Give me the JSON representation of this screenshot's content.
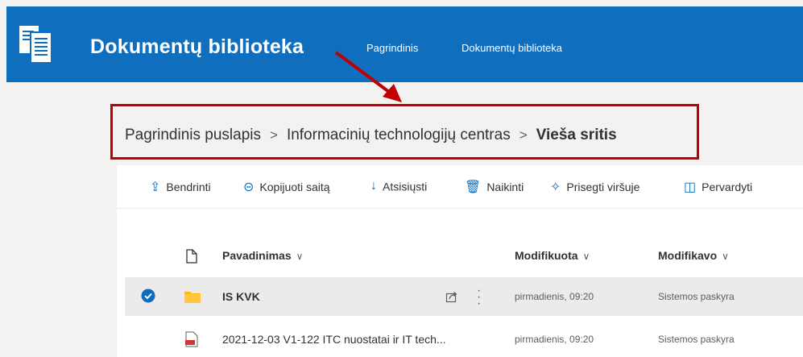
{
  "header": {
    "title": "Dokumentų biblioteka",
    "nav": [
      "Pagrindinis",
      "Dokumentų biblioteka"
    ],
    "background": "#106ebe"
  },
  "breadcrumb": {
    "items": [
      "Pagrindinis puslapis",
      "Informacinių technologijų centras"
    ],
    "current": "Vieša sritis",
    "separator": ">"
  },
  "toolbar": {
    "share": {
      "label": "Bendrinti",
      "icon": "share-icon"
    },
    "copy_link": {
      "label": "Kopijuoti saitą",
      "icon": "link-icon"
    },
    "download": {
      "label": "Atsisiųsti",
      "icon": "download-icon"
    },
    "delete": {
      "label": "Naikinti",
      "icon": "trash-icon"
    },
    "pin": {
      "label": "Prisegti viršuje",
      "icon": "pin-icon"
    },
    "rename": {
      "label": "Pervardyti",
      "icon": "rename-icon"
    }
  },
  "columns": {
    "name": "Pavadinimas",
    "modified": "Modifikuota",
    "modified_by": "Modifikavo"
  },
  "rows": [
    {
      "name": "IS KVK",
      "type": "folder",
      "modified": "pirmadienis, 09:20",
      "modified_by": "Sistemos paskyra",
      "selected": true
    },
    {
      "name": "2021-12-03 V1-122 ITC nuostatai ir IT tech...",
      "type": "pdf",
      "modified": "pirmadienis, 09:20",
      "modified_by": "Sistemos paskyra",
      "selected": false
    }
  ],
  "colors": {
    "accent": "#0f6cbd",
    "annotation": "#c00000"
  }
}
